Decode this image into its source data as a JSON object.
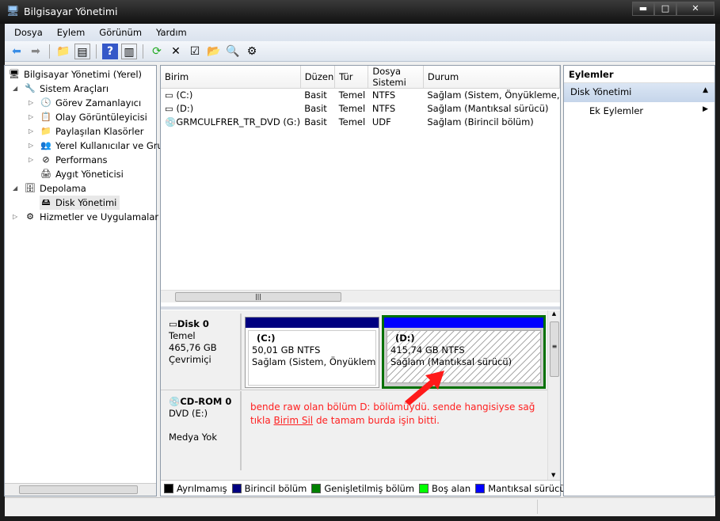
{
  "window": {
    "title": "Bilgisayar Yönetimi",
    "min": "▬",
    "max": "□",
    "close": "✕"
  },
  "menu": [
    "Dosya",
    "Eylem",
    "Görünüm",
    "Yardım"
  ],
  "tree": [
    {
      "label": "Bilgisayar Yönetimi (Yerel)",
      "icon": "computer-icon"
    },
    {
      "label": "Sistem Araçları",
      "icon": "tools-icon"
    },
    {
      "label": "Görev Zamanlayıcı",
      "icon": "clock-icon"
    },
    {
      "label": "Olay Görüntüleyicisi",
      "icon": "event-viewer-icon"
    },
    {
      "label": "Paylaşılan Klasörler",
      "icon": "shared-folder-icon"
    },
    {
      "label": "Yerel Kullanıcılar ve Gru",
      "icon": "users-icon"
    },
    {
      "label": "Performans",
      "icon": "performance-icon"
    },
    {
      "label": "Aygıt Yöneticisi",
      "icon": "device-manager-icon"
    },
    {
      "label": "Depolama",
      "icon": "storage-icon"
    },
    {
      "label": "Disk Yönetimi",
      "icon": "disk-icon"
    },
    {
      "label": "Hizmetler ve Uygulamalar",
      "icon": "services-icon"
    }
  ],
  "volumes": {
    "columns": [
      "Birim",
      "Düzen",
      "Tür",
      "Dosya Sistemi",
      "Durum"
    ],
    "rows": [
      [
        "(C:)",
        "Basit",
        "Temel",
        "NTFS",
        "Sağlam (Sistem, Önyükleme,"
      ],
      [
        "(D:)",
        "Basit",
        "Temel",
        "NTFS",
        "Sağlam (Mantıksal sürücü)"
      ],
      [
        "GRMCULFRER_TR_DVD (G:)",
        "Basit",
        "Temel",
        "UDF",
        "Sağlam (Birincil bölüm)"
      ]
    ]
  },
  "disks": {
    "disk0": {
      "name": "Disk 0",
      "type": "Temel",
      "size": "465,76 GB",
      "state": "Çevrimiçi",
      "c": {
        "label": "(C:)",
        "size": "50,01 GB NTFS",
        "status": "Sağlam (Sistem, Önyükleme, D"
      },
      "d": {
        "label": "(D:)",
        "size": "415,74 GB NTFS",
        "status": "Sağlam (Mantıksal sürücü)"
      }
    },
    "cdrom": {
      "name": "CD-ROM 0",
      "type": "DVD (E:)",
      "media": "Medya Yok"
    }
  },
  "annotation": {
    "line1": "bende raw olan bölüm D: bölümüydü. sende hangisiyse sağ",
    "pre": "tıkla ",
    "link": "Birim Sil",
    "post": " de tamam burda işin bitti.",
    "color": "#ff2020"
  },
  "legend": [
    {
      "label": "Ayrılmamış",
      "color": "#000000"
    },
    {
      "label": "Birincil bölüm",
      "color": "#000080"
    },
    {
      "label": "Genişletilmiş bölüm",
      "color": "#008000"
    },
    {
      "label": "Boş alan",
      "color": "#00ff00"
    },
    {
      "label": "Mantıksal sürücü",
      "color": "#0000ff"
    }
  ],
  "actions": {
    "header": "Eylemler",
    "section": "Disk Yönetimi",
    "more": "Ek Eylemler"
  }
}
